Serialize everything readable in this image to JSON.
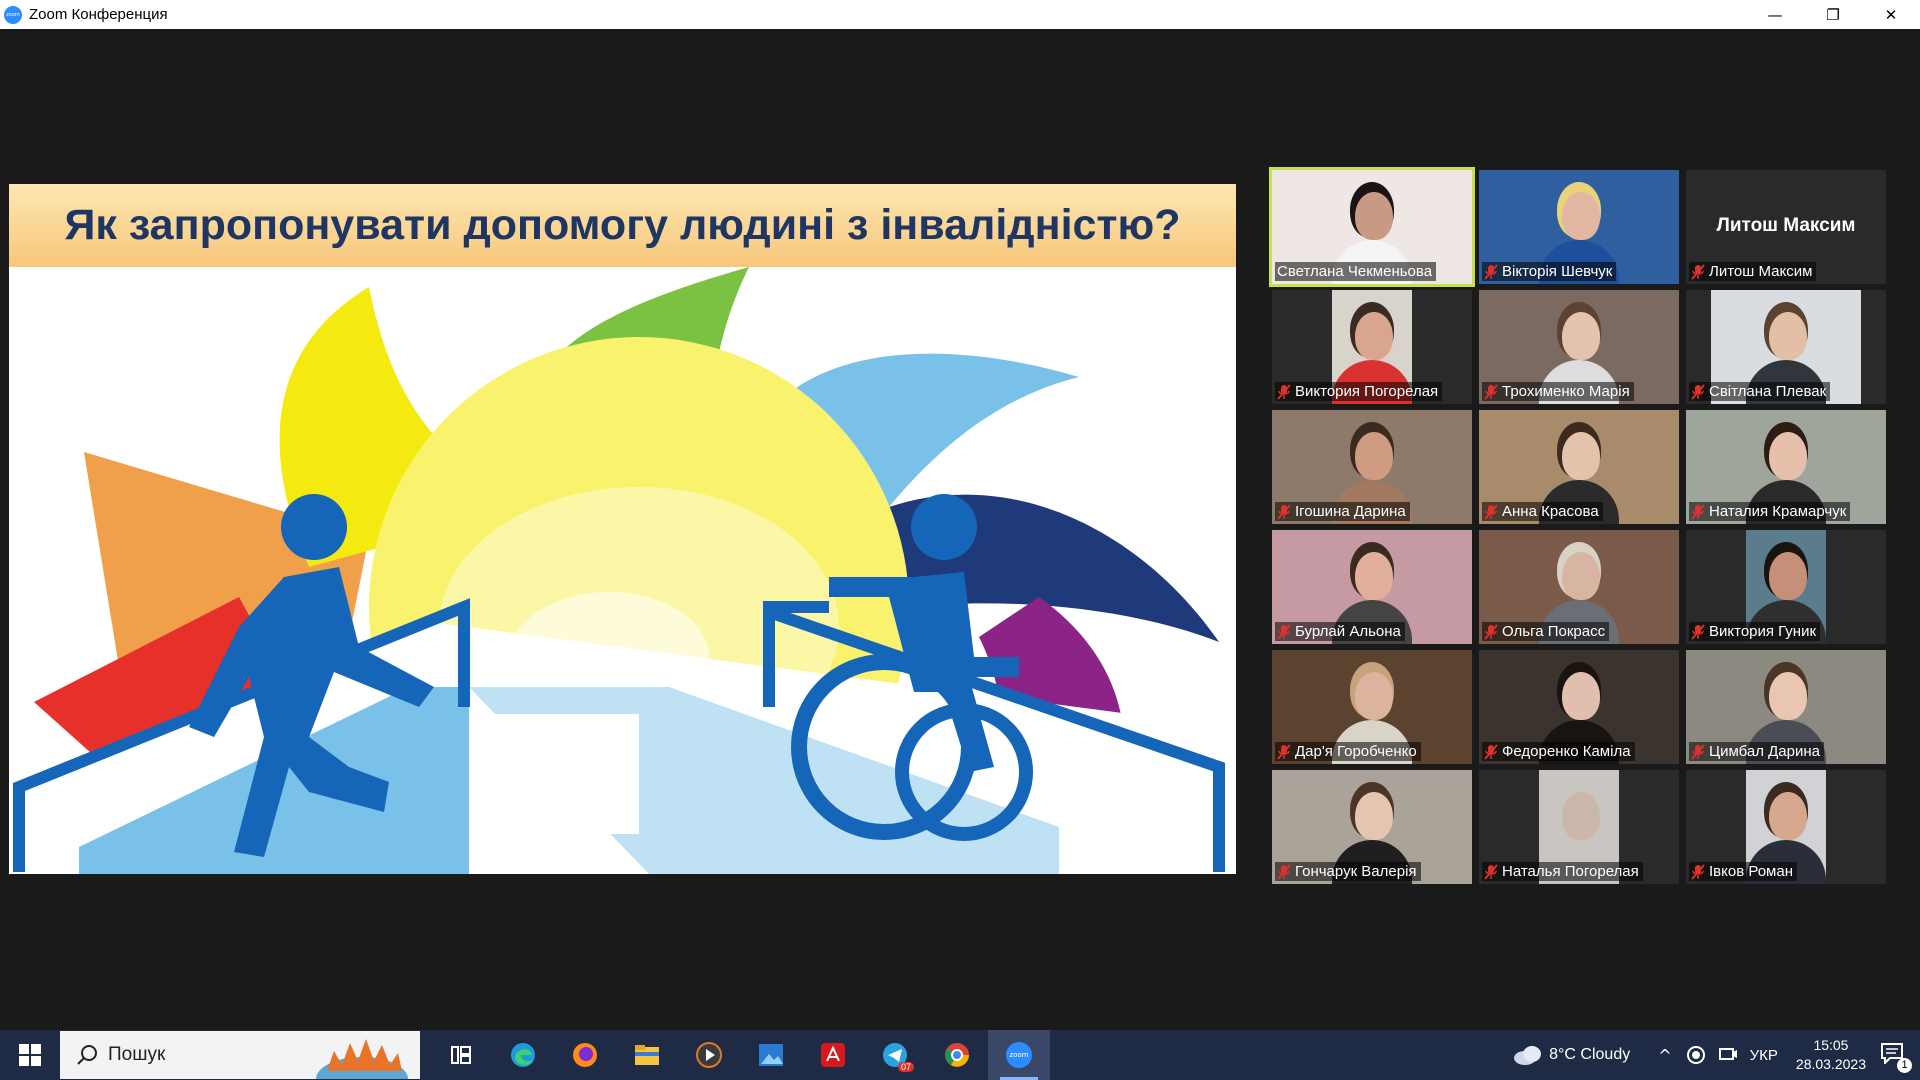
{
  "window": {
    "title": "Zoom Конференция",
    "logo_text": "zoom",
    "minimize": "—",
    "restore": "❐",
    "close": "✕"
  },
  "slide": {
    "title": "Як запропонувати допомогу людині з інвалідністю?"
  },
  "participants": [
    {
      "name": "Светлана Чекменьова",
      "active": true,
      "video": true
    },
    {
      "name": "Вікторія Шевчук",
      "video": true
    },
    {
      "name": "Литош Максим",
      "video": false,
      "avatar_text": "Литош Максим"
    },
    {
      "name": "Виктория Погорелая",
      "video": true
    },
    {
      "name": "Трохименко Марія",
      "video": true
    },
    {
      "name": "Світлана Плевак",
      "video": true
    },
    {
      "name": "Ігошина Дарина",
      "video": true
    },
    {
      "name": "Анна Красова",
      "video": true
    },
    {
      "name": "Наталия Крамарчук",
      "video": true
    },
    {
      "name": "Бурлай Альона",
      "video": true
    },
    {
      "name": "Ольга Покрасс",
      "video": true
    },
    {
      "name": "Виктория Гуник",
      "video": true
    },
    {
      "name": "Дар'я Горобченко",
      "video": true
    },
    {
      "name": "Федоренко Каміла",
      "video": true
    },
    {
      "name": "Цимбал Дарина",
      "video": true
    },
    {
      "name": "Гончарук Валерія",
      "video": true
    },
    {
      "name": "Наталья Погорелая",
      "video": true
    },
    {
      "name": "Івков Роман",
      "video": true
    }
  ],
  "taskbar": {
    "search_placeholder": "Пошук",
    "apps": [
      {
        "icon": "task-view-icon"
      },
      {
        "icon": "edge-icon"
      },
      {
        "icon": "firefox-icon"
      },
      {
        "icon": "file-explorer-icon"
      },
      {
        "icon": "media-player-icon"
      },
      {
        "icon": "photos-icon"
      },
      {
        "icon": "acrobat-icon"
      },
      {
        "icon": "telegram-icon",
        "badge": "07"
      },
      {
        "icon": "chrome-icon"
      },
      {
        "icon": "zoom-icon",
        "label": "zoom"
      }
    ],
    "weather": "8°C  Cloudy",
    "language": "УКР",
    "time": "15:05",
    "date": "28.03.2023",
    "notifications": "1"
  },
  "colors": {
    "title_text": "#1f3564",
    "figure_blue": "#1565b8",
    "active_speaker_border": "#c6e04a",
    "mute_red": "#e0312b"
  }
}
